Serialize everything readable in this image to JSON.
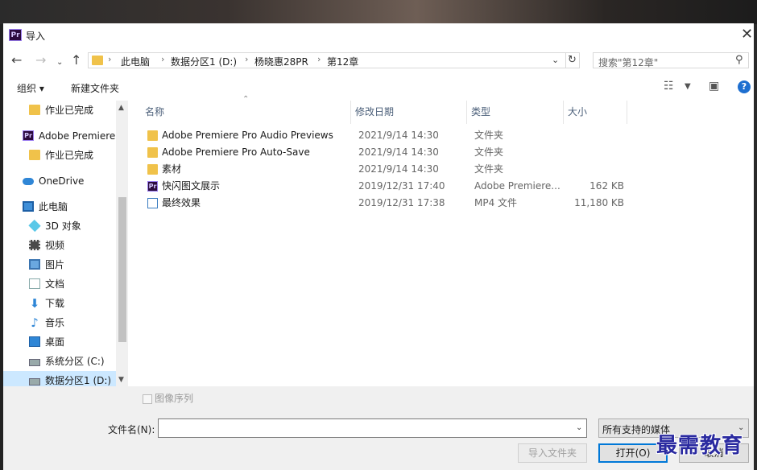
{
  "window": {
    "title": "导入",
    "app_badge": "Pr",
    "close_glyph": "✕"
  },
  "address": {
    "crumbs": [
      "此电脑",
      "数据分区1 (D:)",
      "杨晓惠28PR",
      "第12章"
    ],
    "separator": "›"
  },
  "search": {
    "placeholder": "搜索\"第12章\""
  },
  "toolbar": {
    "organize": "组织 ▾",
    "new_folder": "新建文件夹"
  },
  "sidebar": {
    "items": [
      {
        "label": "作业已完成",
        "icon": "folder-icon"
      },
      {
        "label": "Adobe Premiere",
        "icon": "premiere-icon"
      },
      {
        "label": "作业已完成",
        "icon": "folder-icon"
      },
      {
        "label": "OneDrive",
        "icon": "onedrive-icon"
      },
      {
        "label": "此电脑",
        "icon": "pc-icon"
      },
      {
        "label": "3D 对象",
        "icon": "3d-objects-icon"
      },
      {
        "label": "视频",
        "icon": "video-icon"
      },
      {
        "label": "图片",
        "icon": "pictures-icon"
      },
      {
        "label": "文档",
        "icon": "documents-icon"
      },
      {
        "label": "下载",
        "icon": "download-icon"
      },
      {
        "label": "音乐",
        "icon": "music-icon"
      },
      {
        "label": "桌面",
        "icon": "desktop-icon"
      },
      {
        "label": "系统分区 (C:)",
        "icon": "drive-icon"
      },
      {
        "label": "数据分区1 (D:)",
        "icon": "drive-icon",
        "selected": true
      }
    ]
  },
  "columns": {
    "name": "名称",
    "date": "修改日期",
    "type": "类型",
    "size": "大小"
  },
  "files": [
    {
      "name": "Adobe Premiere Pro Audio Previews",
      "date": "2021/9/14 14:30",
      "type": "文件夹",
      "size": "",
      "icon": "folder-icon"
    },
    {
      "name": "Adobe Premiere Pro Auto-Save",
      "date": "2021/9/14 14:30",
      "type": "文件夹",
      "size": "",
      "icon": "folder-icon"
    },
    {
      "name": "素材",
      "date": "2021/9/14 14:30",
      "type": "文件夹",
      "size": "",
      "icon": "folder-icon"
    },
    {
      "name": "快闪图文展示",
      "date": "2019/12/31 17:40",
      "type": "Adobe Premiere...",
      "size": "162 KB",
      "icon": "premiere-project-icon"
    },
    {
      "name": "最终效果",
      "date": "2019/12/31 17:38",
      "type": "MP4 文件",
      "size": "11,180 KB",
      "icon": "mp4-file-icon"
    }
  ],
  "bottom": {
    "image_sequence": "图像序列",
    "filename_label": "文件名(N):",
    "filename_value": "",
    "filter_value": "所有支持的媒体",
    "import_folder": "导入文件夹",
    "open": "打开(O)",
    "cancel": "取消"
  },
  "watermark": "最需教育"
}
